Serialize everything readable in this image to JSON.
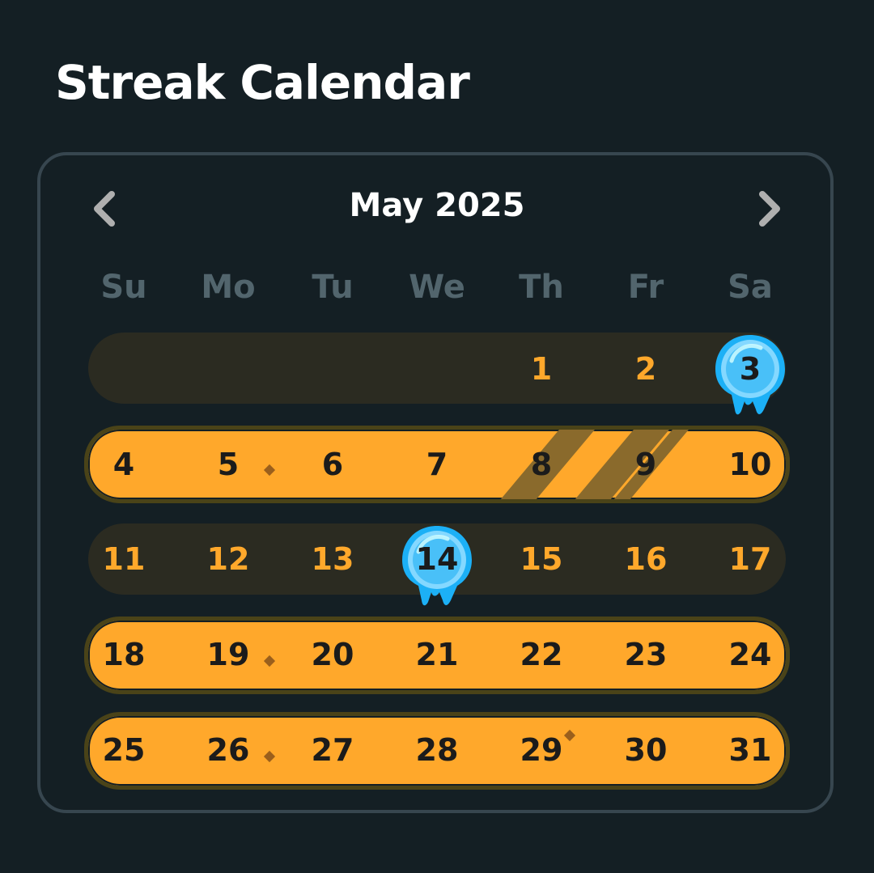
{
  "page_title": "Streak Calendar",
  "calendar": {
    "month_label": "May 2025",
    "prev_icon": "chevron-left-icon",
    "next_icon": "chevron-right-icon",
    "weekdays": [
      "Su",
      "Mo",
      "Tu",
      "We",
      "Th",
      "Fr",
      "Sa"
    ],
    "week1": [
      "1",
      "2",
      "3"
    ],
    "week2": [
      "4",
      "5",
      "6",
      "7",
      "8",
      "9",
      "10"
    ],
    "week3": [
      "11",
      "12",
      "13",
      "14",
      "15",
      "16",
      "17"
    ],
    "week4": [
      "18",
      "19",
      "20",
      "21",
      "22",
      "23",
      "24"
    ],
    "week5": [
      "25",
      "26",
      "27",
      "28",
      "29",
      "30",
      "31"
    ],
    "streak_weeks": [
      2,
      4,
      5
    ],
    "streak_freeze_days": [
      "8",
      "9"
    ],
    "goal_reached_days": [
      "3",
      "14"
    ],
    "marked_days": [
      "5",
      "19",
      "26",
      "29"
    ]
  },
  "colors": {
    "background": "#141f24",
    "card_border": "#37464f",
    "weekday": "#52656d",
    "streak_orange": "#ffa82b",
    "inactive_band": "#2b2b21",
    "freeze_stripe": "#8a6a2c",
    "badge_blue": "#1cb0f6"
  }
}
